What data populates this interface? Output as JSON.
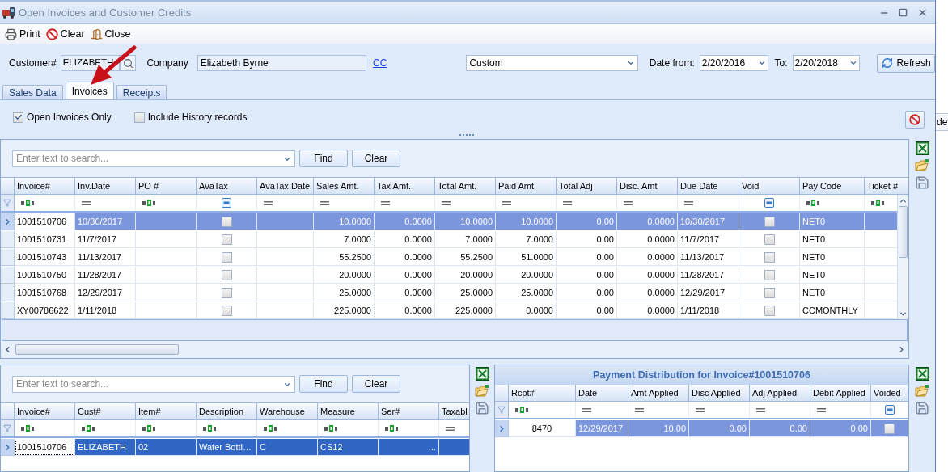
{
  "window": {
    "title": "Open Invoices and Customer Credits"
  },
  "toolbar": [
    {
      "label": "Print",
      "kind": "print"
    },
    {
      "label": "Clear",
      "kind": "clear"
    },
    {
      "label": "Close",
      "kind": "close"
    }
  ],
  "customer": {
    "label": "Customer#",
    "value": "ELIZABETH"
  },
  "company": {
    "label": "Company",
    "value": "Elizabeth Byrne"
  },
  "cc_link": "CC",
  "period": {
    "value": "Custom"
  },
  "date_from": {
    "label": "Date from:",
    "value": "2/20/2016"
  },
  "date_to": {
    "label": "To:",
    "value": "2/20/2018"
  },
  "refresh_button": "Refresh",
  "tabs": [
    {
      "label": "Sales Data",
      "selected": false
    },
    {
      "label": "Invoices",
      "selected": true
    },
    {
      "label": "Receipts",
      "selected": false
    }
  ],
  "options": [
    {
      "label": "Open Invoices Only",
      "checked": true
    },
    {
      "label": "Include History records",
      "checked": false
    }
  ],
  "invoices_grid": {
    "search": {
      "placeholder": "Enter text to search..."
    },
    "find_button": "Find",
    "clear_button": "Clear",
    "focused": false,
    "columns": [
      {
        "label": "Invoice#",
        "kind": "text"
      },
      {
        "label": "Inv.Date",
        "kind": "date"
      },
      {
        "label": "PO #",
        "kind": "text"
      },
      {
        "label": "AvaTax",
        "kind": "check"
      },
      {
        "label": "AvaTax Date",
        "kind": "date"
      },
      {
        "label": "Sales Amt.",
        "kind": "number"
      },
      {
        "label": "Tax Amt.",
        "kind": "number"
      },
      {
        "label": "Total Amt.",
        "kind": "number"
      },
      {
        "label": "Paid Amt.",
        "kind": "number"
      },
      {
        "label": "Total Adj",
        "kind": "number"
      },
      {
        "label": "Disc. Amt",
        "kind": "number"
      },
      {
        "label": "Due Date",
        "kind": "date"
      },
      {
        "label": "Void",
        "kind": "check"
      },
      {
        "label": "Pay Code",
        "kind": "text"
      },
      {
        "label": "Ticket #",
        "kind": "text"
      }
    ],
    "rows": [
      {
        "selected": true,
        "cells": [
          "1001510706",
          "10/30/2017",
          null,
          false,
          null,
          "10.0000",
          "0.0000",
          "10.0000",
          "10.0000",
          "0.00",
          "0.0000",
          "10/30/2017",
          false,
          "NET0",
          null
        ]
      },
      {
        "selected": false,
        "cells": [
          "1001510731",
          "11/7/2017",
          null,
          false,
          null,
          "7.0000",
          "0.0000",
          "7.0000",
          "7.0000",
          "0.00",
          "0.0000",
          "11/7/2017",
          false,
          "NET0",
          null
        ]
      },
      {
        "selected": false,
        "cells": [
          "1001510743",
          "11/13/2017",
          null,
          false,
          null,
          "55.2500",
          "0.0000",
          "55.2500",
          "51.0000",
          "0.00",
          "0.0000",
          "11/13/2017",
          false,
          "NET0",
          null
        ]
      },
      {
        "selected": false,
        "cells": [
          "1001510750",
          "11/28/2017",
          null,
          false,
          null,
          "20.0000",
          "0.0000",
          "20.0000",
          "20.0000",
          "0.00",
          "0.0000",
          "11/28/2017",
          false,
          "NET0",
          null
        ]
      },
      {
        "selected": false,
        "cells": [
          "1001510768",
          "12/29/2017",
          null,
          false,
          null,
          "25.0000",
          "0.0000",
          "25.0000",
          "25.0000",
          "0.00",
          "0.0000",
          "12/29/2017",
          false,
          "NET0",
          null
        ]
      },
      {
        "selected": false,
        "cells": [
          "XY00786622",
          "1/11/2018",
          null,
          false,
          null,
          "225.0000",
          "0.0000",
          "225.0000",
          "0.0000",
          "0.00",
          "0.0000",
          "1/11/2018",
          false,
          "CCMONTHLY",
          null
        ]
      }
    ]
  },
  "lines_grid": {
    "search": {
      "placeholder": "Enter text to search..."
    },
    "find_button": "Find",
    "clear_button": "Clear",
    "focused": true,
    "columns": [
      {
        "label": "Invoice#",
        "kind": "text"
      },
      {
        "label": "Cust#",
        "kind": "text"
      },
      {
        "label": "Item#",
        "kind": "text"
      },
      {
        "label": "Description",
        "kind": "text"
      },
      {
        "label": "Warehouse",
        "kind": "text"
      },
      {
        "label": "Measure",
        "kind": "text"
      },
      {
        "label": "Ser#",
        "kind": "lookup"
      },
      {
        "label": "Taxabl",
        "kind": "date"
      }
    ],
    "rows": [
      {
        "selected": true,
        "cells": [
          "1001510706",
          "ELIZABETH",
          "02",
          "Water Bottl…",
          "C",
          "CS12",
          "...",
          null
        ]
      }
    ]
  },
  "payments_grid": {
    "title": "Payment Distribution for Invoice#1001510706",
    "focused": false,
    "columns": [
      {
        "label": "Rcpt#",
        "kind": "id"
      },
      {
        "label": "Date",
        "kind": "date"
      },
      {
        "label": "Amt Applied",
        "kind": "number"
      },
      {
        "label": "Disc Applied",
        "kind": "number"
      },
      {
        "label": "Adj Applied",
        "kind": "number"
      },
      {
        "label": "Debit Applied",
        "kind": "number"
      },
      {
        "label": "Voided",
        "kind": "check"
      }
    ],
    "rows": [
      {
        "selected": true,
        "cells": [
          "8470",
          "12/29/2017",
          "10.00",
          "0.00",
          "0.00",
          "0.00",
          false
        ]
      }
    ]
  },
  "background_window": {
    "text": "de"
  }
}
